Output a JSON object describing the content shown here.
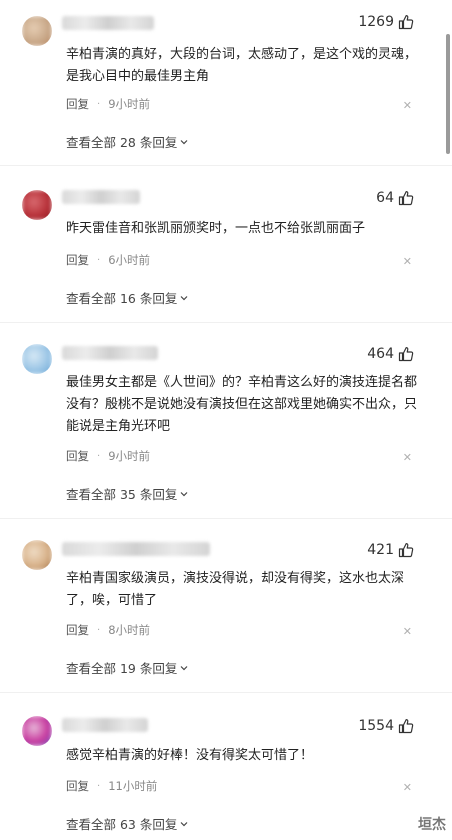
{
  "comments": [
    {
      "likes": "1269",
      "text": "辛柏青演的真好，大段的台词，太感动了，是这个戏的灵魂，是我心目中的最佳男主角",
      "reply_label": "回复",
      "time": "9小时前",
      "view_all": "查看全部 28 条回复",
      "avatar_colors": [
        "#c9a98a",
        "#b8865f",
        "#e6cdb3"
      ]
    },
    {
      "likes": "64",
      "text": "昨天雷佳音和张凯丽颁奖时，一点也不给张凯丽面子",
      "reply_label": "回复",
      "time": "6小时前",
      "view_all": "查看全部 16 条回复",
      "avatar_colors": [
        "#8e1b22",
        "#b8323a",
        "#d86a6f"
      ]
    },
    {
      "likes": "464",
      "text": "最佳男女主都是《人世间》的？辛柏青这么好的演技连提名都没有？殷桃不是说她没有演技但在这部戏里她确实不出众，只能说是主角光环吧",
      "reply_label": "回复",
      "time": "9小时前",
      "view_all": "查看全部 35 条回复",
      "avatar_colors": [
        "#9cc6e6",
        "#6aa7d6",
        "#d7e9f5"
      ]
    },
    {
      "likes": "421",
      "text": "辛柏青国家级演员，演技没得说，却没有得奖，这水也太深了，唉，可惜了",
      "reply_label": "回复",
      "time": "8小时前",
      "view_all": "查看全部 19 条回复",
      "avatar_colors": [
        "#d8b28a",
        "#a57449",
        "#efdcc5"
      ]
    },
    {
      "likes": "1554",
      "text": "感觉辛柏青演的好棒！没有得奖太可惜了！",
      "reply_label": "回复",
      "time": "11小时前",
      "view_all": "查看全部 63 条回复",
      "avatar_colors": [
        "#6d62c9",
        "#c83a9e",
        "#e7b7d8"
      ]
    }
  ],
  "watermark": "垣杰"
}
